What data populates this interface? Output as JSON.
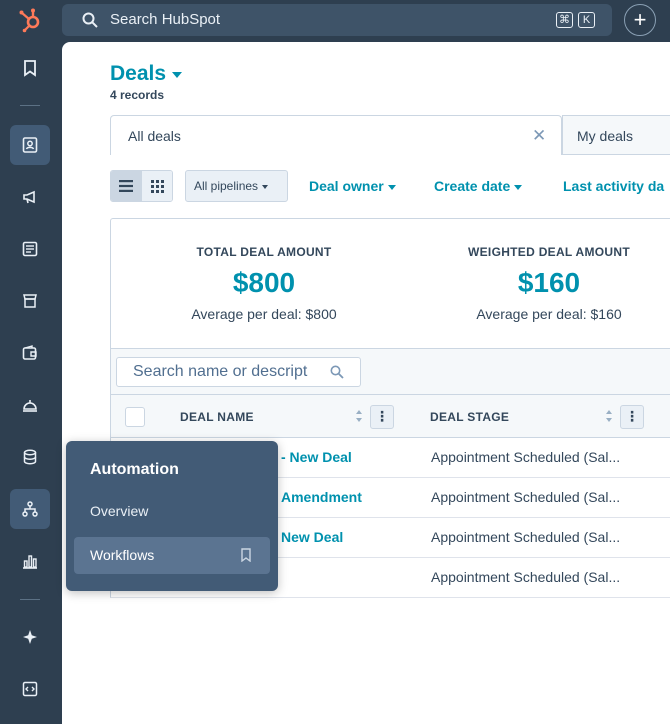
{
  "topbar": {
    "search_placeholder": "Search HubSpot",
    "shortcut_keys": [
      "⌘",
      "K"
    ],
    "brand_color": "#ff7a59"
  },
  "sidenav": {
    "items": [
      {
        "name": "bookmarks-icon",
        "active": false
      },
      {
        "name": "contacts-icon",
        "active": true
      },
      {
        "name": "marketing-icon",
        "active": false
      },
      {
        "name": "content-icon",
        "active": false
      },
      {
        "name": "commerce-icon",
        "active": false
      },
      {
        "name": "sales-icon",
        "active": false
      },
      {
        "name": "service-icon",
        "active": false
      },
      {
        "name": "data-icon",
        "active": false
      },
      {
        "name": "automation-icon",
        "active": true
      },
      {
        "name": "reporting-icon",
        "active": false
      },
      {
        "name": "ai-icon",
        "active": false
      },
      {
        "name": "developer-icon",
        "active": false
      }
    ]
  },
  "page": {
    "title": "Deals",
    "records": "4 records"
  },
  "views": {
    "tabs": [
      {
        "label": "All deals"
      },
      {
        "label": "My deals"
      }
    ]
  },
  "filters": {
    "pipeline": "All pipelines",
    "items": [
      "Deal owner",
      "Create date",
      "Last activity da"
    ]
  },
  "summary": {
    "stats": [
      {
        "label": "TOTAL DEAL AMOUNT",
        "value": "$800",
        "average": "Average per deal: $800"
      },
      {
        "label": "WEIGHTED DEAL AMOUNT",
        "value": "$160",
        "average": "Average per deal: $160"
      }
    ]
  },
  "table": {
    "search_placeholder": "Search name or descript",
    "columns": [
      "DEAL NAME",
      "DEAL STAGE"
    ],
    "rows": [
      {
        "name": "- New Deal",
        "stage": "Appointment Scheduled (Sal..."
      },
      {
        "name": "Amendment",
        "stage": "Appointment Scheduled (Sal..."
      },
      {
        "name": "New Deal",
        "stage": "Appointment Scheduled (Sal..."
      },
      {
        "name": "",
        "stage": "Appointment Scheduled (Sal..."
      }
    ]
  },
  "popover": {
    "title": "Automation",
    "items": [
      "Overview",
      "Workflows"
    ]
  },
  "colors": {
    "accent": "#0091ae",
    "nav_bg": "#2e3f50",
    "popover_bg": "#425b76"
  }
}
